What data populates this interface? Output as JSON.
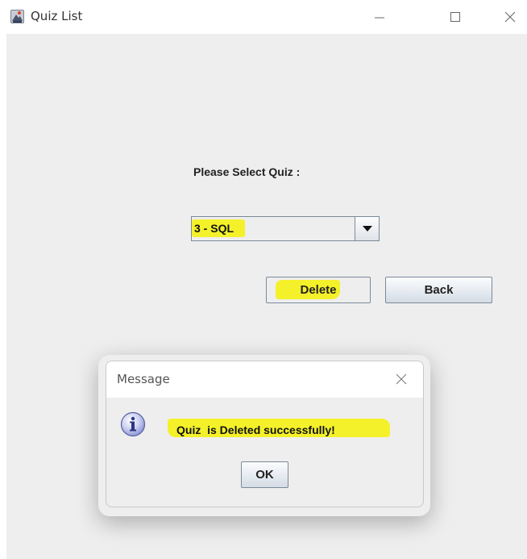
{
  "window": {
    "title": "Quiz List",
    "controls": {
      "minimize": "minimize-icon",
      "maximize": "maximize-icon",
      "close": "close-icon"
    }
  },
  "form": {
    "prompt_label": "Please Select Quiz :",
    "quiz_select": {
      "selected": "3 - SQL"
    },
    "delete_label": "Delete",
    "back_label": "Back"
  },
  "dialog": {
    "title": "Message",
    "message": "Quiz  is Deleted successfully!",
    "ok_label": "OK",
    "icon": "info-icon"
  },
  "colors": {
    "highlight": "#f4f12a",
    "panel_bg": "#eeeeee",
    "button_border": "#7a8a99"
  }
}
